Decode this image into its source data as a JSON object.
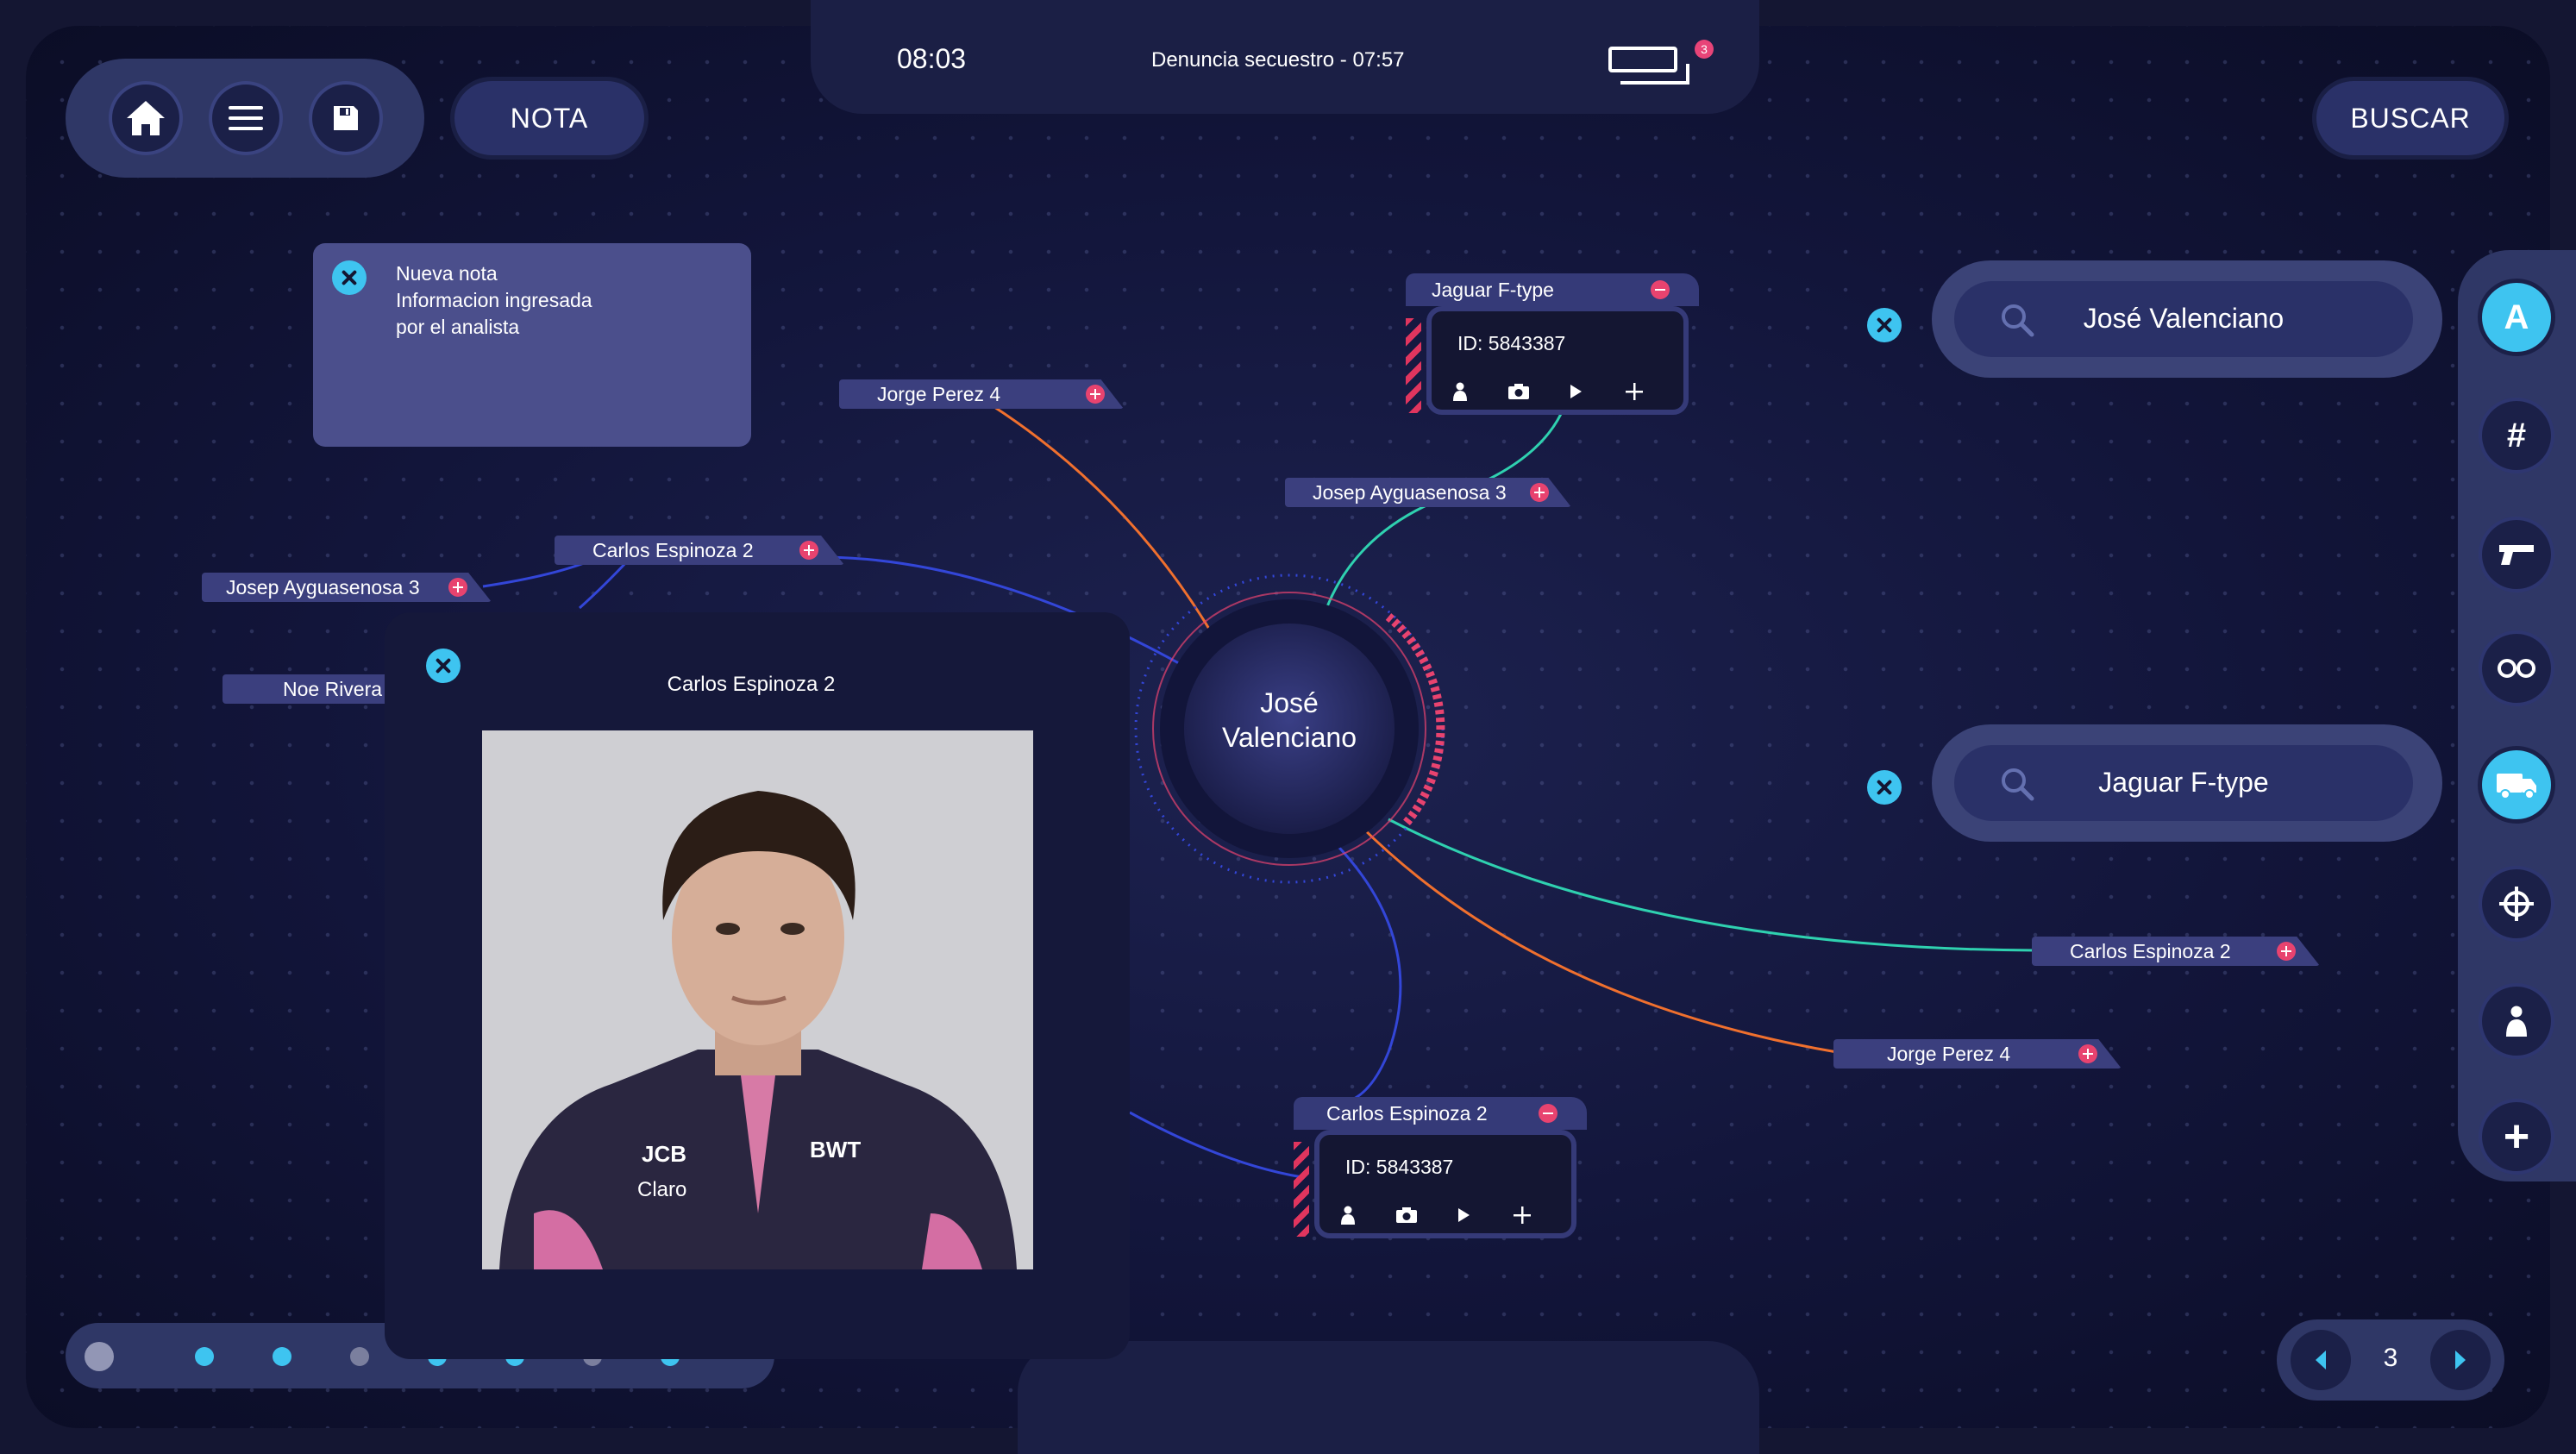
{
  "header": {
    "time": "08:03",
    "case_title": "Denuncia secuestro  -  07:57",
    "notifications_count": "3"
  },
  "toolbar": {
    "nota_label": "NOTA",
    "buscar_label": "BUSCAR"
  },
  "note": {
    "lines": [
      "Nueva nota",
      "Informacion ingresada",
      "por el analista"
    ]
  },
  "graph": {
    "center_first": "José",
    "center_last": "Valenciano",
    "tags": [
      "Jorge Perez 4",
      "Carlos Espinoza 2",
      "Josep Ayguasenosa 3",
      "Noe Rivera",
      "Josep Ayguasenosa 3",
      "Carlos Espinoza 2",
      "Jorge Perez 4"
    ],
    "cards": [
      {
        "title": "Jaguar F-type",
        "id": "ID: 5843387"
      },
      {
        "title": "Carlos Espinoza 2",
        "id": "ID: 5843387"
      }
    ],
    "colors": {
      "orange": "#f0702e",
      "blue": "#3346d8",
      "teal": "#2fd1b0",
      "red": "#e8436f"
    }
  },
  "photo_panel": {
    "title": "Carlos Espinoza 2"
  },
  "search": {
    "queries": [
      "José Valenciano",
      "Jaguar F-type"
    ]
  },
  "rail": {
    "buttons": [
      "letter-a-icon",
      "hashtag-icon",
      "pistol-icon",
      "handcuffs-icon",
      "truck-icon",
      "crosshair-icon",
      "person-icon",
      "plus-icon"
    ],
    "letter": "A",
    "hash": "#",
    "plus": "+"
  },
  "pager": {
    "page": "3"
  },
  "timeline_dots": {
    "colors": [
      "#9296b5",
      "#3ec4f0",
      "#3ec4f0",
      "#7b7f9e",
      "#3ec4f0",
      "#3ec4f0",
      "#7b7f9e",
      "#3ec4f0"
    ]
  }
}
